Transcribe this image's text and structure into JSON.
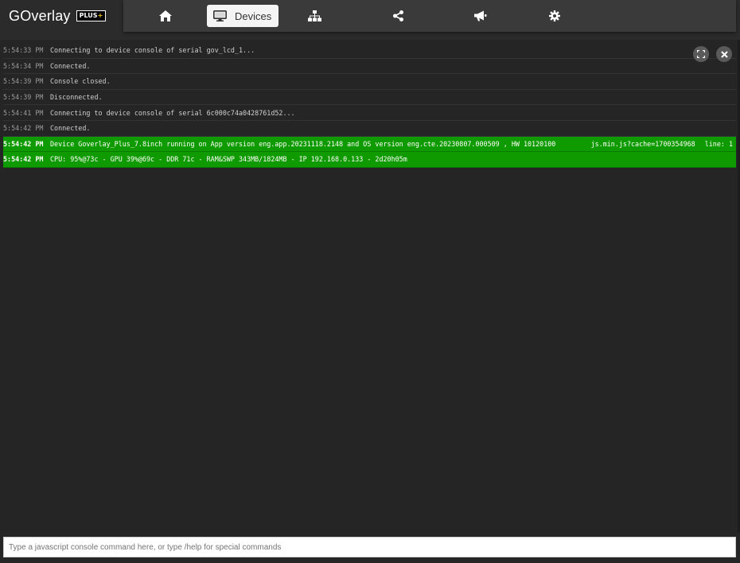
{
  "brand": {
    "name": "GOverlay",
    "badge_main": "PLUS",
    "badge_accent": "+"
  },
  "nav": {
    "items": [
      {
        "key": "home",
        "icon": "home-icon",
        "label": ""
      },
      {
        "key": "devices",
        "icon": "monitor-icon",
        "label": "Devices",
        "active": true
      },
      {
        "key": "network",
        "icon": "sitemap-icon",
        "label": ""
      },
      {
        "key": "share",
        "icon": "share-icon",
        "label": ""
      },
      {
        "key": "announce",
        "icon": "bullhorn-icon",
        "label": ""
      },
      {
        "key": "settings",
        "icon": "gear-icon",
        "label": ""
      }
    ]
  },
  "console": {
    "controls": [
      {
        "key": "fullscreen",
        "icon": "fullscreen-icon"
      },
      {
        "key": "close",
        "icon": "close-icon"
      }
    ],
    "rows": [
      {
        "time": "5:54:33 PM",
        "msg": "Connecting to device console of serial gov_lcd_1..."
      },
      {
        "time": "5:54:34 PM",
        "msg": "Connected."
      },
      {
        "time": "5:54:39 PM",
        "msg": "Console closed."
      },
      {
        "time": "5:54:39 PM",
        "msg": "Disconnected."
      },
      {
        "time": "5:54:41 PM",
        "msg": "Connecting to device console of serial 6c000c74a0428761d52..."
      },
      {
        "time": "5:54:42 PM",
        "msg": "Connected."
      },
      {
        "time": "5:54:42 PM",
        "msg": "Device Goverlay_Plus_7.8inch running on App version eng.app.20231118.2148 and OS version eng.cte.20230807.000509 , HW 10120100",
        "highlight": true,
        "source": "js.min.js?cache=1700354968",
        "line": "line: 1"
      },
      {
        "time": "5:54:42 PM",
        "msg": "CPU: 95%@73c - GPU 39%@69c - DDR 71c - RAM&SWP 343MB/1824MB - IP 192.168.0.133 - 2d20h05m",
        "highlight": true
      }
    ],
    "input_placeholder": "Type a javascript console command here, or type /help for special commands",
    "input_value": ""
  },
  "colors": {
    "highlight": "#0f9a00",
    "background": "#252525",
    "nav_bg": "#3a3a3a",
    "badge_accent": "#f2c200"
  }
}
